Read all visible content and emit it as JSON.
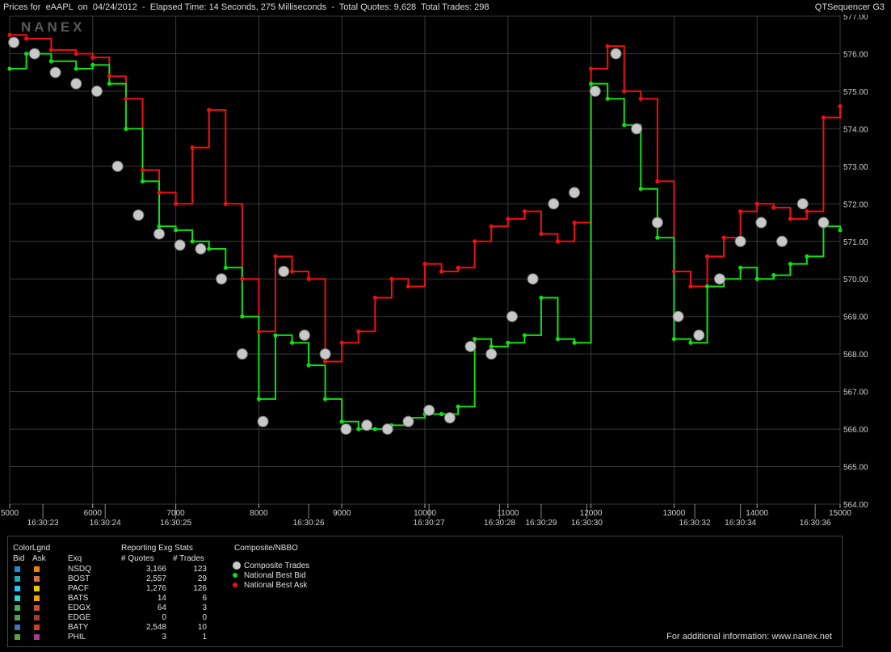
{
  "header": {
    "left_text": "Prices for  eAAPL  on  04/24/2012  -  Elapsed Time: 14 Seconds, 275 Milliseconds  -  Total Quotes: 9,628  Total Trades: 298",
    "right_text": "QTSequencer G3",
    "watermark": "NANEX"
  },
  "chart_data": {
    "type": "line",
    "ylim": [
      564.0,
      577.0
    ],
    "y_ticks": [
      "577.00",
      "576.00",
      "575.00",
      "574.00",
      "573.00",
      "572.00",
      "571.00",
      "570.00",
      "569.00",
      "568.00",
      "567.00",
      "566.00",
      "565.00",
      "564.00"
    ],
    "xlim": [
      5000,
      15000
    ],
    "x_ticks_seq": [
      "5000",
      "6000",
      "7000",
      "8000",
      "9000",
      "10000",
      "11000",
      "12000",
      "13000",
      "14000",
      "15000"
    ],
    "x_ticks_time": [
      {
        "x": 5400,
        "label": "16:30:23"
      },
      {
        "x": 6150,
        "label": "16:30:24"
      },
      {
        "x": 7000,
        "label": "16:30:25"
      },
      {
        "x": 8600,
        "label": "16:30:26"
      },
      {
        "x": 10050,
        "label": "16:30:27"
      },
      {
        "x": 10900,
        "label": "16:30:28"
      },
      {
        "x": 11400,
        "label": "16:30:29"
      },
      {
        "x": 11950,
        "label": "16:30:30"
      },
      {
        "x": 13250,
        "label": "16:30:32"
      },
      {
        "x": 13800,
        "label": "16:30:34"
      },
      {
        "x": 14700,
        "label": "16:30:36"
      }
    ],
    "series": [
      {
        "name": "National Best Bid",
        "x": [
          5000,
          5200,
          5500,
          5800,
          6000,
          6200,
          6400,
          6600,
          6800,
          7000,
          7200,
          7400,
          7600,
          7800,
          8000,
          8200,
          8400,
          8600,
          8800,
          9000,
          9200,
          9400,
          9600,
          9800,
          10000,
          10200,
          10400,
          10600,
          10800,
          11000,
          11200,
          11400,
          11600,
          11800,
          12000,
          12200,
          12400,
          12600,
          12800,
          13000,
          13200,
          13400,
          13600,
          13800,
          14000,
          14200,
          14400,
          14600,
          14800,
          15000
        ],
        "y": [
          575.6,
          576.0,
          575.8,
          575.6,
          575.7,
          575.2,
          574.0,
          572.6,
          571.4,
          571.3,
          571.0,
          570.8,
          570.3,
          569.0,
          566.8,
          568.5,
          568.3,
          567.7,
          566.8,
          566.2,
          566.0,
          566.0,
          566.1,
          566.3,
          566.4,
          566.4,
          566.6,
          568.4,
          568.2,
          568.3,
          568.5,
          569.5,
          568.4,
          568.3,
          575.2,
          574.8,
          574.1,
          572.4,
          571.1,
          568.4,
          568.3,
          569.8,
          570.0,
          570.3,
          570.0,
          570.1,
          570.4,
          570.6,
          571.4,
          571.3
        ]
      },
      {
        "name": "National Best Ask",
        "x": [
          5000,
          5200,
          5500,
          5800,
          6000,
          6200,
          6400,
          6600,
          6800,
          7000,
          7200,
          7400,
          7600,
          7800,
          8000,
          8200,
          8400,
          8600,
          8800,
          9000,
          9200,
          9400,
          9600,
          9800,
          10000,
          10200,
          10400,
          10600,
          10800,
          11000,
          11200,
          11400,
          11600,
          11800,
          12000,
          12200,
          12400,
          12600,
          12800,
          13000,
          13200,
          13400,
          13600,
          13800,
          14000,
          14200,
          14400,
          14600,
          14800,
          15000
        ],
        "y": [
          576.5,
          576.4,
          576.1,
          576.0,
          575.9,
          575.4,
          574.8,
          572.9,
          572.3,
          572.0,
          573.5,
          574.5,
          572.0,
          570.0,
          568.6,
          570.6,
          570.2,
          570.0,
          567.8,
          568.3,
          568.6,
          569.5,
          570.0,
          569.8,
          570.4,
          570.2,
          570.3,
          571.0,
          571.4,
          571.6,
          571.8,
          571.2,
          571.0,
          571.5,
          575.6,
          576.2,
          575.0,
          574.8,
          572.6,
          570.2,
          569.8,
          570.6,
          571.1,
          571.8,
          572.0,
          571.9,
          571.6,
          571.8,
          574.3,
          574.6
        ]
      },
      {
        "name": "Composite Trades",
        "x": [
          5050,
          5300,
          5550,
          5800,
          6050,
          6300,
          6550,
          6800,
          7050,
          7300,
          7550,
          7800,
          8050,
          8300,
          8550,
          8800,
          9050,
          9300,
          9550,
          9800,
          10050,
          10300,
          10550,
          10800,
          11050,
          11300,
          11550,
          11800,
          12050,
          12300,
          12550,
          12800,
          13050,
          13300,
          13550,
          13800,
          14050,
          14300,
          14550,
          14800
        ],
        "y": [
          576.3,
          576.0,
          575.5,
          575.2,
          575.0,
          573.0,
          571.7,
          571.2,
          570.9,
          570.8,
          570.0,
          568.0,
          566.2,
          570.2,
          568.5,
          568.0,
          566.0,
          566.1,
          566.0,
          566.2,
          566.5,
          566.3,
          568.2,
          568.0,
          569.0,
          570.0,
          572.0,
          572.3,
          575.0,
          576.0,
          574.0,
          571.5,
          569.0,
          568.5,
          570.0,
          571.0,
          571.5,
          571.0,
          572.0,
          571.5
        ]
      }
    ],
    "colors": {
      "bid": "#11e011",
      "ask": "#ee1111",
      "trade": "#c8c8c8",
      "grid": "#3a3a3a",
      "axis_text": "#d0d0d0"
    }
  },
  "legend": {
    "color_title": "ColorLgnd",
    "col_bid": "Bid",
    "col_ask": "Ask",
    "stats_title": "Reporting Exg Stats",
    "col_exq": "Exq",
    "col_quotes": "# Quotes",
    "col_trades": "# Trades",
    "nbbo_title": "Composite/NBBO",
    "nbbo_items": [
      {
        "label": "Composite Trades",
        "color": "#c8c8c8"
      },
      {
        "label": "National Best Bid",
        "color": "#11e011"
      },
      {
        "label": "National Best Ask",
        "color": "#ee1111"
      }
    ],
    "exchanges": [
      {
        "name": "NSDQ",
        "quotes": "3,166",
        "trades": "123",
        "bid_color": "#1a8fd8",
        "ask_color": "#f08000"
      },
      {
        "name": "BOST",
        "quotes": "2,557",
        "trades": "29",
        "bid_color": "#1ab0b0",
        "ask_color": "#d07050"
      },
      {
        "name": "PACF",
        "quotes": "1,276",
        "trades": "126",
        "bid_color": "#22c4ff",
        "ask_color": "#e8c800"
      },
      {
        "name": "BATS",
        "quotes": "14",
        "trades": "6",
        "bid_color": "#2ad8d0",
        "ask_color": "#f0a000"
      },
      {
        "name": "EDGX",
        "quotes": "64",
        "trades": "3",
        "bid_color": "#40b060",
        "ask_color": "#c05030"
      },
      {
        "name": "EDGE",
        "quotes": "0",
        "trades": "0",
        "bid_color": "#50a050",
        "ask_color": "#a04030"
      },
      {
        "name": "BATY",
        "quotes": "2,548",
        "trades": "10",
        "bid_color": "#4070c0",
        "ask_color": "#d04020"
      },
      {
        "name": "PHIL",
        "quotes": "3",
        "trades": "1",
        "bid_color": "#60a040",
        "ask_color": "#a04080"
      }
    ],
    "footer": "For additional information: www.nanex.net"
  }
}
